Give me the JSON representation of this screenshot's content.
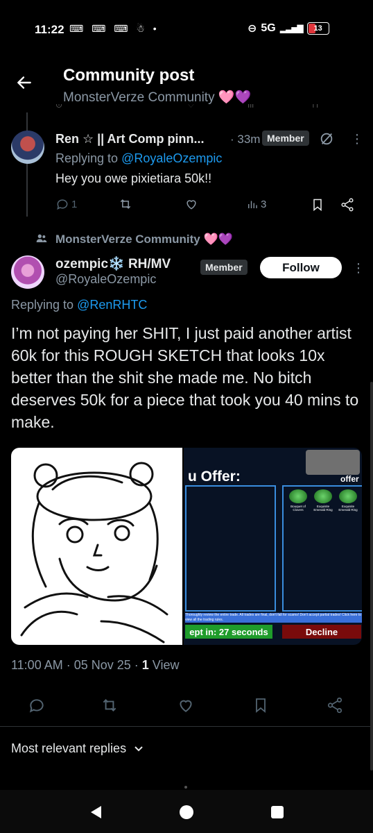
{
  "status_bar": {
    "time": "11:22",
    "left_icons": "⌨ ⌨ ⌨ ☃ •",
    "network": "5G",
    "battery": "13"
  },
  "header": {
    "title": "Community post",
    "subtitle": "MonsterVerze Community 🩷💜"
  },
  "reply_tweet": {
    "name": "Ren ☆ || Art Comp pinn...",
    "time": "· 33m",
    "badge": "Member",
    "replying_prefix": "Replying to ",
    "replying_handle": "@RoyaleOzempic",
    "text": "Hey you owe pixietiara 50k!!",
    "reply_count": "1",
    "view_count": "3"
  },
  "community_label": "MonsterVerze Community 🩷💜",
  "main_tweet": {
    "name": "ozempic❄️ RH/MV",
    "handle": "@RoyaleOzempic",
    "badge": "Member",
    "follow_label": "Follow",
    "replying_prefix": "Replying to ",
    "replying_handle": "@RenRHTC",
    "text": "I’m not paying her SHIT, I just paid another artist 60k for this ROUGH SKETCH that looks 10x better than the shit she made me. No bitch deserves 50k for a piece that took you 40 mins to make.",
    "timestamp": "11:00 AM · 05 Nov 25 · ",
    "views_count": "1",
    "views_label": " View"
  },
  "trade_image": {
    "title": "u Offer:",
    "right_title": "offer",
    "items": [
      "Bouquet of Clovers",
      "Exquisite Emerald Ring",
      "Exquisite Emerald Ring"
    ],
    "warning": "Thoroughly review the entire trade. All trades are final, don't fall for scams! Don't accept partial trades! Click here to view all the trading rules.",
    "accept_label": "ept in: 27 seconds",
    "decline_label": "Decline"
  },
  "replies_sort": "Most relevant replies"
}
